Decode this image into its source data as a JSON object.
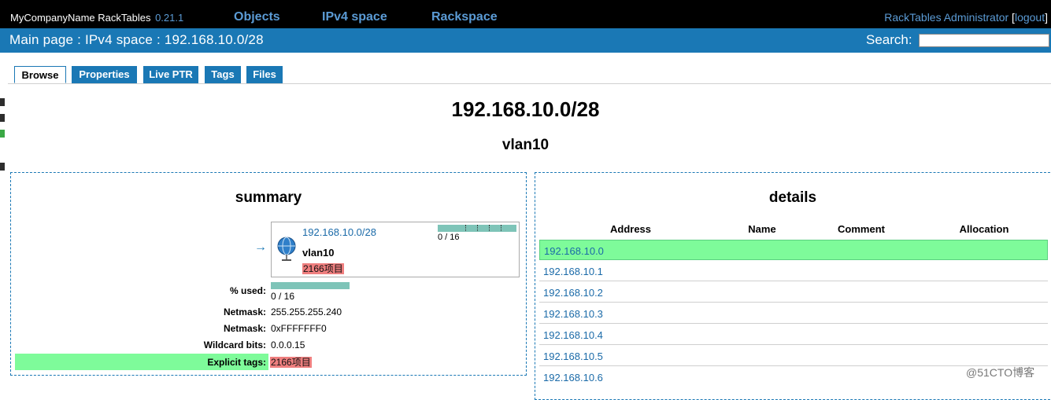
{
  "header": {
    "brand": "MyCompanyName RackTables",
    "version": "0.21.1",
    "nav": [
      "Objects",
      "IPv4 space",
      "Rackspace"
    ],
    "user": "RackTables Administrator",
    "bracket_open": " [",
    "logout": "logout",
    "bracket_close": "]"
  },
  "breadcrumb": {
    "text": "Main page : IPv4 space : 192.168.10.0/28",
    "search_label": "Search:"
  },
  "tabs": [
    "Browse",
    "Properties",
    "Live PTR",
    "Tags",
    "Files"
  ],
  "page": {
    "network": "192.168.10.0/28",
    "name": "vlan10"
  },
  "summary": {
    "title": "summary",
    "arrow": "→",
    "card": {
      "network": "192.168.10.0/28",
      "name": "vlan10",
      "tag": "2166项目",
      "usage": "0 / 16",
      "used_fraction": 0
    },
    "rows": {
      "used_label": "% used:",
      "used_value": "0 / 16",
      "netmask_label": "Netmask:",
      "netmask_value": "255.255.255.240",
      "netmask_hex_label": "Netmask:",
      "netmask_hex_value": "0xFFFFFFF0",
      "wildcard_label": "Wildcard bits:",
      "wildcard_value": "0.0.0.15",
      "tags_label": "Explicit tags:",
      "tags_value": "2166项目"
    }
  },
  "details": {
    "title": "details",
    "columns": [
      "Address",
      "Name",
      "Comment",
      "Allocation"
    ],
    "addresses": [
      "192.168.10.0",
      "192.168.10.1",
      "192.168.10.2",
      "192.168.10.3",
      "192.168.10.4",
      "192.168.10.5",
      "192.168.10.6"
    ]
  },
  "watermark": "@51CTO博客",
  "colors": {
    "topbar": "#000000",
    "pathbar": "#1a78b5",
    "link": "#1a6aa8",
    "highlight": "#7efb9a",
    "tag": "#ef7f7f",
    "usage_bar": "#7ec4b8"
  }
}
